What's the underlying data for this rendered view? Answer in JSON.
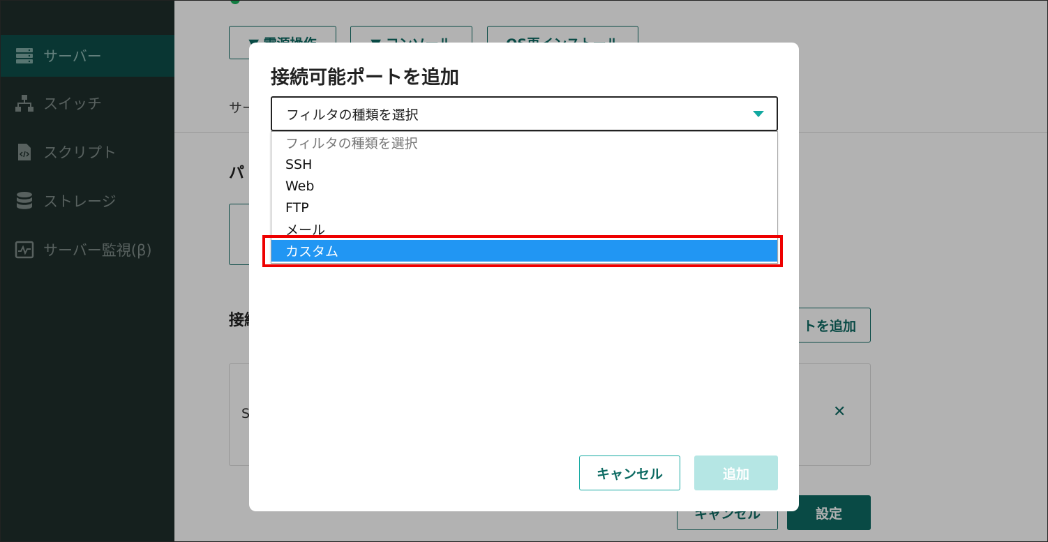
{
  "sidebar": {
    "items": [
      {
        "label": "サーバー",
        "icon": "server-icon",
        "active": true
      },
      {
        "label": "スイッチ",
        "icon": "network-switch-icon",
        "active": false
      },
      {
        "label": "スクリプト",
        "icon": "script-file-icon",
        "active": false
      },
      {
        "label": "ストレージ",
        "icon": "database-icon",
        "active": false
      },
      {
        "label": "サーバー監視(β)",
        "icon": "monitor-chart-icon",
        "active": false
      }
    ]
  },
  "main": {
    "actions": [
      {
        "label": "▼ 電源操作"
      },
      {
        "label": "▼ コンソール"
      },
      {
        "label": "OS再インストール"
      }
    ],
    "info_label": "サー",
    "section1_title": "パ",
    "section2_title": "接続",
    "add_port_label": "トを追加",
    "port_row_text": "S",
    "footer": {
      "cancel": "キャンセル",
      "set": "設定"
    }
  },
  "modal": {
    "title": "接続可能ポートを追加",
    "select": {
      "value": "フィルタの種類を選択",
      "options": [
        "フィルタの種類を選択",
        "SSH",
        "Web",
        "FTP",
        "メール",
        "カスタム"
      ],
      "highlighted": "カスタム"
    },
    "cancel_label": "キャンセル",
    "add_label": "追加"
  },
  "colors": {
    "accent": "#0d6b63",
    "selected_option": "#2196f3",
    "highlight_box": "#ee0000",
    "sidebar_bg": "#1f2f2c"
  }
}
